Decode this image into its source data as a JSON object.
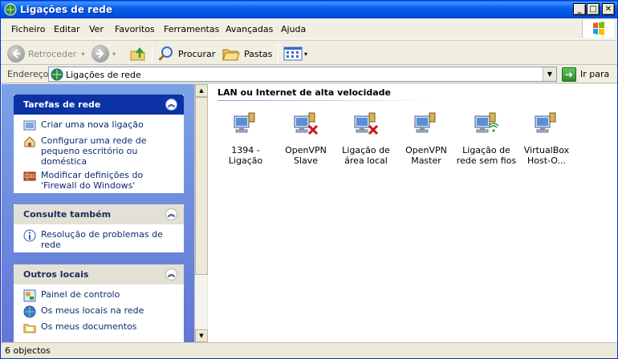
{
  "window": {
    "title": "Ligações de rede"
  },
  "menu": [
    "Ficheiro",
    "Editar",
    "Ver",
    "Favoritos",
    "Ferramentas",
    "Avançadas",
    "Ajuda"
  ],
  "toolbar": {
    "back_label": "Retroceder",
    "search_label": "Procurar",
    "folders_label": "Pastas"
  },
  "address": {
    "label": "Endereço",
    "value": "Ligações de rede",
    "go_label": "Ir para"
  },
  "tasks": {
    "title": "Tarefas de rede",
    "items": [
      "Criar uma nova ligação",
      "Configurar uma rede de pequeno escritório ou doméstica",
      "Modificar definições do 'Firewall do Windows'"
    ]
  },
  "see_also": {
    "title": "Consulte também",
    "items": [
      "Resolução de problemas de rede"
    ]
  },
  "other_places": {
    "title": "Outros locais",
    "items": [
      "Painel de controlo",
      "Os meus locais na rede",
      "Os meus documentos"
    ]
  },
  "content": {
    "group_title": "LAN ou Internet de alta velocidade",
    "items": [
      {
        "label": "1394 - Ligação",
        "icon": "network-connection-icon"
      },
      {
        "label": "OpenVPN Slave",
        "icon": "network-disconnected-icon"
      },
      {
        "label": "Ligação de área local",
        "icon": "network-disconnected-icon"
      },
      {
        "label": "OpenVPN Master",
        "icon": "network-connection-icon"
      },
      {
        "label": "Ligação de rede sem fios",
        "icon": "wireless-network-icon"
      },
      {
        "label": "VirtualBox Host-O...",
        "icon": "network-connection-icon"
      }
    ]
  },
  "status": {
    "text": "6 objectos"
  },
  "colors": {
    "titlebar": "#0a5fe8",
    "taskpane": "#7ba2e7",
    "panel_header": "#0c32a6"
  }
}
